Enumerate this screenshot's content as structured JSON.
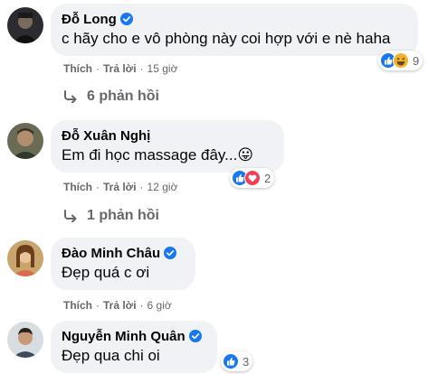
{
  "comments": [
    {
      "author": "Đỗ Long",
      "verified": true,
      "text": "c hãy cho e vô phòng này coi hợp với e nè haha",
      "actions": {
        "like": "Thích",
        "reply": "Trả lời",
        "time": "15 giờ"
      },
      "reactions": {
        "icons": [
          "like-icon",
          "haha-icon"
        ],
        "count": "9"
      },
      "replies_label": "6 phản hồi"
    },
    {
      "author": "Đỗ Xuân Nghị",
      "verified": false,
      "text": "Em đi học massage đây...😛",
      "actions": {
        "like": "Thích",
        "reply": "Trả lời",
        "time": "12 giờ"
      },
      "reactions": {
        "icons": [
          "like-icon",
          "love-icon"
        ],
        "count": "2"
      },
      "replies_label": "1 phản hồi"
    },
    {
      "author": "Đào Minh Châu",
      "verified": true,
      "text": "Đẹp quá c ơi",
      "actions": {
        "like": "Thích",
        "reply": "Trả lời",
        "time": "6 giờ"
      }
    },
    {
      "author": "Nguyễn Minh Quân",
      "verified": true,
      "text": "Đẹp qua chi oi",
      "reactions": {
        "icons": [
          "like-icon"
        ],
        "count": "3"
      }
    }
  ],
  "colors": {
    "bubble": "#f0f2f5",
    "muted": "#65676b",
    "like_blue": "#1877f2",
    "love_red": "#f33e58",
    "haha_yellow": "#f7b125"
  }
}
